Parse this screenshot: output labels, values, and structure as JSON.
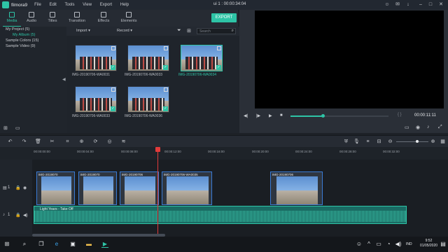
{
  "app": {
    "name": "filmora9",
    "project_title": "ui 1 : 00:00:34:04"
  },
  "menu": [
    "File",
    "Edit",
    "Tools",
    "View",
    "Export",
    "Help"
  ],
  "tabs": [
    {
      "label": "Media",
      "icon": "folder-icon",
      "active": true
    },
    {
      "label": "Audio",
      "icon": "music-icon",
      "active": false
    },
    {
      "label": "Titles",
      "icon": "text-icon",
      "active": false
    },
    {
      "label": "Transition",
      "icon": "transition-icon",
      "active": false
    },
    {
      "label": "Effects",
      "icon": "effects-icon",
      "active": false
    },
    {
      "label": "Elements",
      "icon": "image-icon",
      "active": false
    }
  ],
  "export_label": "EXPORT",
  "library": [
    {
      "label": "My Project (5)",
      "sub": false
    },
    {
      "label": "My Album (5)",
      "sub": true
    },
    {
      "label": "Sample Colors (15)",
      "sub": false
    },
    {
      "label": "Sample Video (9)",
      "sub": false
    }
  ],
  "media_toolbar": {
    "import": "Import",
    "record": "Record",
    "search_placeholder": "Search"
  },
  "media": [
    {
      "name": "IMG-20190706-WA0031",
      "selected": false
    },
    {
      "name": "IMG-20190706-WA0033",
      "selected": false
    },
    {
      "name": "IMG-20190706-WA0034",
      "selected": true
    },
    {
      "name": "IMG-20190706-WA0033",
      "selected": false
    },
    {
      "name": "IMG-20190706-WA0036",
      "selected": false
    }
  ],
  "preview": {
    "timecode": "00:00:11:11",
    "progress": 0.33,
    "marks": "{  }"
  },
  "ruler": [
    "00:00:00:00",
    "00:00:04:00",
    "00:00:08:00",
    "00:00:12:00",
    "00:00:16:00",
    "00:00:20:00",
    "00:00:24:00",
    "00:00:28:00",
    "00:00:32:00"
  ],
  "clips": [
    {
      "label": "IMG-2019070"
    },
    {
      "label": "IMG-2019070"
    },
    {
      "label": "IMG-20190706"
    },
    {
      "label": "IMG-20190706-WA0035"
    },
    {
      "label": "IMG-20190706"
    }
  ],
  "audio_clip": {
    "label": "Light Years - Take Off"
  },
  "track_labels": {
    "video": "1",
    "audio": "1"
  },
  "taskbar": {
    "time": "9:52",
    "date": "01/05/2020",
    "lang": "IND"
  }
}
